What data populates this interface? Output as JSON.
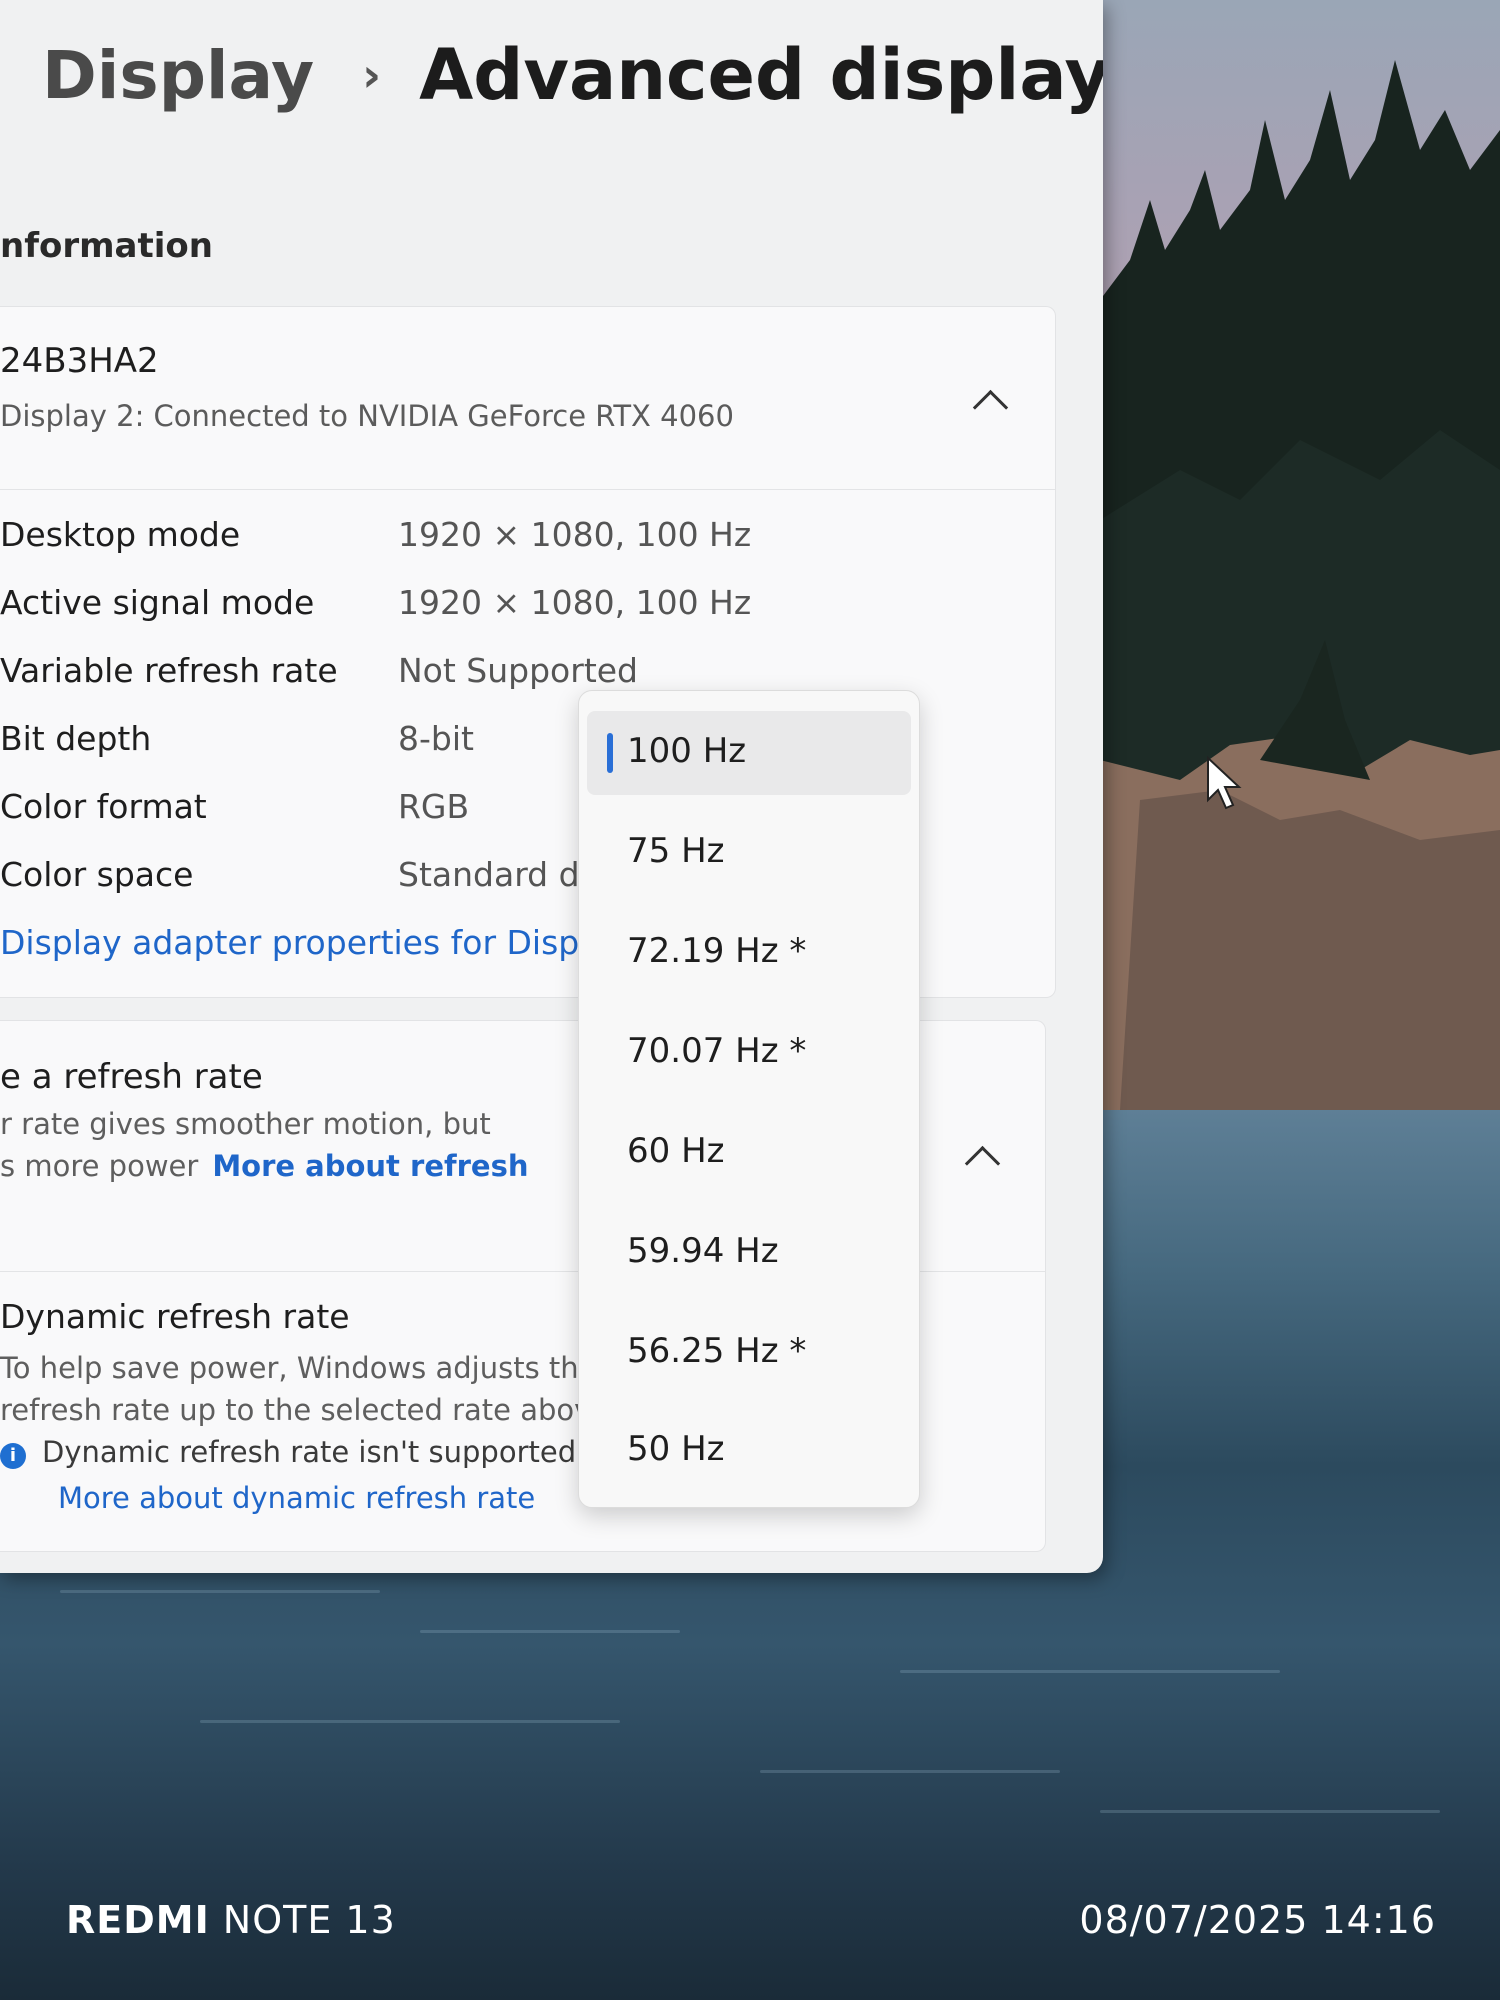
{
  "breadcrumb": {
    "parent": "Display",
    "separator": "›",
    "current": "Advanced display"
  },
  "display_info": {
    "section_title": "nformation",
    "name": "24B3HA2",
    "subtitle": "Display 2: Connected to NVIDIA GeForce RTX 4060",
    "specs": [
      {
        "label": "Desktop mode",
        "value": "1920 × 1080, 100 Hz"
      },
      {
        "label": "Active signal mode",
        "value": "1920 × 1080, 100 Hz"
      },
      {
        "label": "Variable refresh rate",
        "value": "Not Supported"
      },
      {
        "label": "Bit depth",
        "value": "8-bit"
      },
      {
        "label": "Color format",
        "value": "RGB"
      },
      {
        "label": "Color space",
        "value": "Standard d"
      }
    ],
    "adapter_link": "Display adapter properties for Disp"
  },
  "refresh": {
    "title": "e a refresh rate",
    "desc_line1": "r rate gives smoother motion, but",
    "desc_line2": "s more power",
    "more_link": "More about refresh",
    "dynamic_title": "Dynamic refresh rate",
    "dynamic_desc1": "To help save power, Windows adjusts th",
    "dynamic_desc2": "refresh rate up to the selected rate abov",
    "dynamic_note": "Dynamic refresh rate isn't supported",
    "dynamic_link": "More about dynamic refresh rate",
    "info_icon": "i"
  },
  "dropdown": {
    "selected_index": 0,
    "options": [
      "100 Hz",
      "75 Hz",
      "72.19 Hz *",
      "70.07 Hz *",
      "60 Hz",
      "59.94 Hz",
      "56.25 Hz *",
      "50 Hz"
    ]
  },
  "watermark": {
    "brand_bold": "REDMI",
    "brand_rest": " NOTE 13",
    "datetime": "08/07/2025 14:16"
  },
  "icons": {
    "card_chevron": "chevron-up-icon",
    "info": "info-icon",
    "pointer": "mouse-pointer-icon"
  },
  "colors": {
    "accent": "#2a6fd6",
    "link": "#1f66c9",
    "window_bg": "#f0f1f2"
  }
}
